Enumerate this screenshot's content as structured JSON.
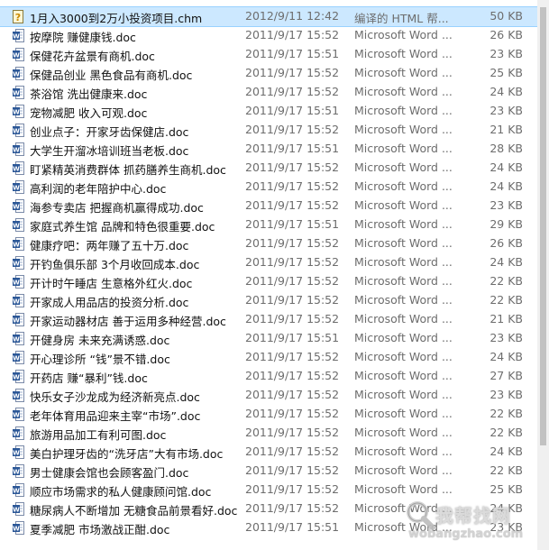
{
  "files": [
    {
      "name": "1月入3000到2万小投资项目.chm",
      "date": "2012/9/11 12:42",
      "type": "编译的 HTML 帮...",
      "size": "50 KB",
      "icon": "chm-help-icon"
    },
    {
      "name": "按摩院 赚健康钱.doc",
      "date": "2011/9/17 15:52",
      "type": "Microsoft Word ...",
      "size": "26 KB",
      "icon": "word-doc-icon"
    },
    {
      "name": "保健花卉盆景有商机.doc",
      "date": "2011/9/17 15:51",
      "type": "Microsoft Word ...",
      "size": "23 KB",
      "icon": "word-doc-icon"
    },
    {
      "name": "保健品创业 黑色食品有商机.doc",
      "date": "2011/9/17 15:52",
      "type": "Microsoft Word ...",
      "size": "25 KB",
      "icon": "word-doc-icon"
    },
    {
      "name": "茶浴馆 洗出健康来.doc",
      "date": "2011/9/17 15:52",
      "type": "Microsoft Word ...",
      "size": "24 KB",
      "icon": "word-doc-icon"
    },
    {
      "name": "宠物减肥 收入可观.doc",
      "date": "2011/9/17 15:51",
      "type": "Microsoft Word ...",
      "size": "23 KB",
      "icon": "word-doc-icon"
    },
    {
      "name": "创业点子：开家牙齿保健店.doc",
      "date": "2011/9/17 15:52",
      "type": "Microsoft Word ...",
      "size": "21 KB",
      "icon": "word-doc-icon"
    },
    {
      "name": "大学生开溜冰培训班当老板.doc",
      "date": "2011/9/17 15:51",
      "type": "Microsoft Word ...",
      "size": "28 KB",
      "icon": "word-doc-icon"
    },
    {
      "name": "盯紧精英消费群体 抓药膳养生商机.doc",
      "date": "2011/9/17 15:52",
      "type": "Microsoft Word ...",
      "size": "24 KB",
      "icon": "word-doc-icon"
    },
    {
      "name": "高利润的老年陪护中心.doc",
      "date": "2011/9/17 15:52",
      "type": "Microsoft Word ...",
      "size": "24 KB",
      "icon": "word-doc-icon"
    },
    {
      "name": "海参专卖店 把握商机赢得成功.doc",
      "date": "2011/9/17 15:52",
      "type": "Microsoft Word ...",
      "size": "23 KB",
      "icon": "word-doc-icon"
    },
    {
      "name": "家庭式养生馆 品牌和特色很重要.doc",
      "date": "2011/9/17 15:51",
      "type": "Microsoft Word ...",
      "size": "29 KB",
      "icon": "word-doc-icon"
    },
    {
      "name": "健康疗吧：两年赚了五十万.doc",
      "date": "2011/9/17 15:52",
      "type": "Microsoft Word ...",
      "size": "26 KB",
      "icon": "word-doc-icon"
    },
    {
      "name": "开钓鱼俱乐部 3个月收回成本.doc",
      "date": "2011/9/17 15:52",
      "type": "Microsoft Word ...",
      "size": "24 KB",
      "icon": "word-doc-icon"
    },
    {
      "name": "开计时午睡店 生意格外红火.doc",
      "date": "2011/9/17 15:52",
      "type": "Microsoft Word ...",
      "size": "22 KB",
      "icon": "word-doc-icon"
    },
    {
      "name": "开家成人用品店的投资分析.doc",
      "date": "2011/9/17 15:52",
      "type": "Microsoft Word ...",
      "size": "22 KB",
      "icon": "word-doc-icon"
    },
    {
      "name": "开家运动器材店 善于运用多种经营.doc",
      "date": "2011/9/17 15:52",
      "type": "Microsoft Word ...",
      "size": "21 KB",
      "icon": "word-doc-icon"
    },
    {
      "name": "开健身房 未来充满诱惑.doc",
      "date": "2011/9/17 15:51",
      "type": "Microsoft Word ...",
      "size": "23 KB",
      "icon": "word-doc-icon"
    },
    {
      "name": "开心理诊所 “钱”景不错.doc",
      "date": "2011/9/17 15:52",
      "type": "Microsoft Word ...",
      "size": "24 KB",
      "icon": "word-doc-icon"
    },
    {
      "name": "开药店 赚“暴利”钱.doc",
      "date": "2011/9/17 15:52",
      "type": "Microsoft Word ...",
      "size": "27 KB",
      "icon": "word-doc-icon"
    },
    {
      "name": "快乐女子沙龙成为经济新亮点.doc",
      "date": "2011/9/17 15:52",
      "type": "Microsoft Word ...",
      "size": "23 KB",
      "icon": "word-doc-icon"
    },
    {
      "name": "老年体育用品迎来主宰“市场”.doc",
      "date": "2011/9/17 15:52",
      "type": "Microsoft Word ...",
      "size": "22 KB",
      "icon": "word-doc-icon"
    },
    {
      "name": "旅游用品加工有利可图.doc",
      "date": "2011/9/17 15:52",
      "type": "Microsoft Word ...",
      "size": "22 KB",
      "icon": "word-doc-icon"
    },
    {
      "name": "美白护理牙齿的“洗牙店”大有市场.doc",
      "date": "2011/9/17 15:52",
      "type": "Microsoft Word ...",
      "size": "24 KB",
      "icon": "word-doc-icon"
    },
    {
      "name": "男士健康会馆也会顾客盈门.doc",
      "date": "2011/9/17 15:52",
      "type": "Microsoft Word ...",
      "size": "22 KB",
      "icon": "word-doc-icon"
    },
    {
      "name": "顺应市场需求的私人健康顾问馆.doc",
      "date": "2011/9/17 15:52",
      "type": "Microsoft Word ...",
      "size": "25 KB",
      "icon": "word-doc-icon"
    },
    {
      "name": "糖尿病人不断增加 无糖食品前景看好.doc",
      "date": "2011/9/17 15:52",
      "type": "Microsoft Word ...",
      "size": "24 KB",
      "icon": "word-doc-icon"
    },
    {
      "name": "夏季减肥 市场激战正酣.doc",
      "date": "2011/9/17 15:51",
      "type": "Microsoft Word ...",
      "size": "23 KB",
      "icon": "word-doc-icon"
    }
  ],
  "watermark": {
    "title": "我帮找网",
    "subtitle": "wobangzhao.com"
  },
  "colors": {
    "selected_bg": "#cce8ff",
    "secondary_text": "#6d6d6d",
    "word_icon": "#2b5797",
    "chm_icon": "#e0a400"
  }
}
